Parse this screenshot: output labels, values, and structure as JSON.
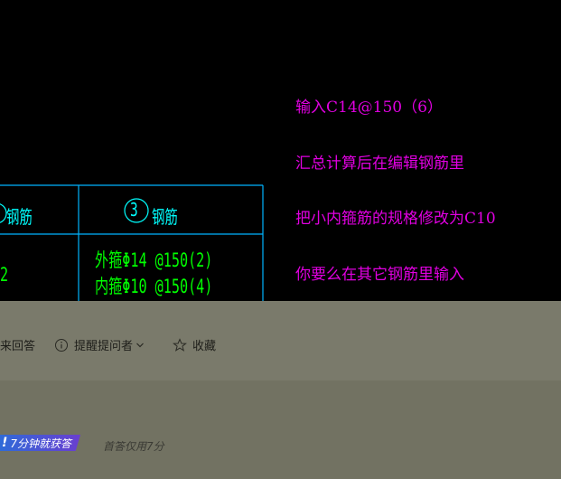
{
  "cad": {
    "note_lines": [
      "输入C14@150（6）",
      "汇总计算后在编辑钢筋里",
      "把小内箍筋的规格修改为C10",
      "你要么在其它钢筋里输入"
    ],
    "table": {
      "col2_header_partial": "钢筋",
      "col3_circle_num": "3",
      "col3_header": "钢筋",
      "col2_value_partial": "2",
      "col3_value_line1": "外箍Φ14 @150(2)",
      "col3_value_line2": "内箍Φ10 @150(4)"
    },
    "colors": {
      "note": "#e100e1",
      "grid": "#00b4ff",
      "text": "#00ff00",
      "header": "#00ffff"
    }
  },
  "actions": {
    "answer_partial": "来回答",
    "remind_label": "提醒提问者",
    "favorite_label": "收藏"
  },
  "badge": {
    "bang": "!",
    "text": "7分钟就获答",
    "sub": "首答仅用7分"
  }
}
